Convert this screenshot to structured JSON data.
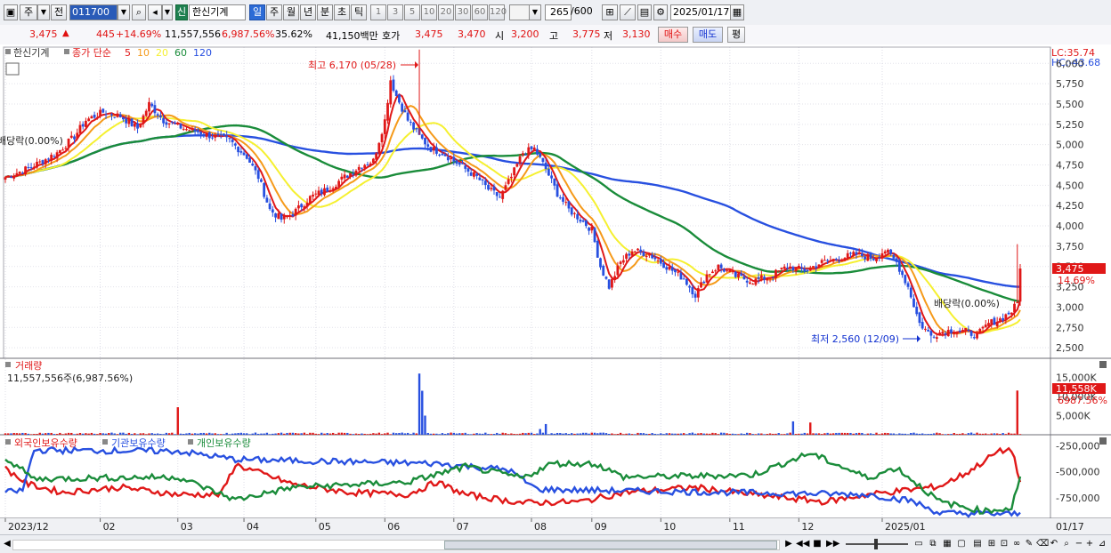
{
  "toolbar": {
    "market_label": "주",
    "prev_label": "전",
    "code": "011700",
    "stock_name_badge": "신",
    "stock_name": "한신기계",
    "periods": [
      "일",
      "주",
      "월",
      "년",
      "분",
      "초",
      "틱"
    ],
    "selected_period": "일",
    "minute_intervals": [
      "1",
      "3",
      "5",
      "10",
      "20",
      "30",
      "60",
      "120"
    ],
    "count": "265",
    "count_total": "/600",
    "date": "2025/01/17"
  },
  "info": {
    "price": "3,475",
    "change_arrow": "▲",
    "change": "445",
    "change_pct": "+14.69%",
    "volume": "11,557,556",
    "volume_pct": "6,987.56%",
    "turnover_pct": "35.62%",
    "amount": "41,150백만",
    "quote_label": "호가",
    "ask": "3,475",
    "bid": "3,470",
    "open_label": "시",
    "open": "3,200",
    "high_label": "고",
    "high": "3,775",
    "low_label": "저",
    "low": "3,130",
    "buy_button": "매수",
    "sell_button": "매도",
    "eval_button": "평"
  },
  "price_panel": {
    "stock_label": "한신기계",
    "legend_prefix": "종가 단순",
    "ma_periods": [
      "5",
      "10",
      "20",
      "60",
      "120"
    ],
    "ma_colors": [
      "#e01818",
      "#f59a1a",
      "#f5f030",
      "#1a8c3a",
      "#2850e0"
    ],
    "lc_label": "LC:35.74",
    "hc_label": "HC:-43.68",
    "high_annotation": "최고 6,170 (05/28)",
    "low_annotation": "최저 2,560 (12/09)",
    "dividend_left": "배당락(0.00%)",
    "dividend_right": "배당락(0.00%)",
    "current_price_tag": "3,475",
    "current_pct_tag": "14.69%"
  },
  "volume_panel": {
    "title": "거래량",
    "value": "11,557,556주(6,987.56%)",
    "tag": "11,558K",
    "tag_pct": "6987.56%"
  },
  "holding_panel": {
    "legend": [
      "외국인보유수량",
      "기관보유수량",
      "개인보유수량"
    ],
    "colors": [
      "#e01818",
      "#2850e0",
      "#1a8c3a"
    ]
  },
  "x_axis_labels": [
    "2023/12",
    "02",
    "03",
    "04",
    "05",
    "06",
    "07",
    "08",
    "09",
    "10",
    "11",
    "12",
    "2025/01"
  ],
  "x_axis_right_label": "01/17",
  "chart_data": [
    {
      "type": "candlestick",
      "title": "한신기계",
      "y_ticks": [
        6000,
        5750,
        5500,
        5250,
        5000,
        4750,
        4500,
        4250,
        4000,
        3750,
        3500,
        3250,
        3000,
        2750,
        2500
      ],
      "ylim": [
        2370,
        6200
      ],
      "anchors": [
        [
          0,
          4600
        ],
        [
          6,
          4680
        ],
        [
          12,
          4780
        ],
        [
          18,
          4900
        ],
        [
          24,
          5100
        ],
        [
          28,
          5300
        ],
        [
          34,
          5400
        ],
        [
          40,
          5350
        ],
        [
          46,
          5200
        ],
        [
          50,
          5500
        ],
        [
          55,
          5300
        ],
        [
          62,
          5200
        ],
        [
          68,
          5150
        ],
        [
          72,
          5100
        ],
        [
          78,
          5050
        ],
        [
          84,
          4850
        ],
        [
          88,
          4600
        ],
        [
          92,
          4200
        ],
        [
          96,
          4080
        ],
        [
          100,
          4150
        ],
        [
          106,
          4350
        ],
        [
          112,
          4450
        ],
        [
          118,
          4600
        ],
        [
          124,
          4750
        ],
        [
          128,
          4800
        ],
        [
          132,
          5300
        ],
        [
          134,
          5800
        ],
        [
          136,
          5600
        ],
        [
          140,
          5300
        ],
        [
          144,
          5100
        ],
        [
          148,
          4950
        ],
        [
          152,
          4900
        ],
        [
          156,
          4800
        ],
        [
          160,
          4700
        ],
        [
          164,
          4600
        ],
        [
          168,
          4450
        ],
        [
          172,
          4350
        ],
        [
          176,
          4600
        ],
        [
          180,
          4900
        ],
        [
          184,
          4950
        ],
        [
          188,
          4700
        ],
        [
          192,
          4400
        ],
        [
          196,
          4200
        ],
        [
          200,
          4080
        ],
        [
          204,
          3950
        ],
        [
          207,
          3500
        ],
        [
          210,
          3250
        ],
        [
          214,
          3550
        ],
        [
          218,
          3700
        ],
        [
          224,
          3650
        ],
        [
          230,
          3500
        ],
        [
          236,
          3350
        ],
        [
          240,
          3150
        ],
        [
          244,
          3400
        ],
        [
          248,
          3500
        ],
        [
          254,
          3380
        ],
        [
          260,
          3320
        ],
        [
          266,
          3380
        ],
        [
          272,
          3500
        ],
        [
          278,
          3450
        ],
        [
          284,
          3550
        ],
        [
          290,
          3600
        ],
        [
          296,
          3650
        ],
        [
          302,
          3600
        ],
        [
          306,
          3700
        ],
        [
          310,
          3550
        ],
        [
          314,
          3250
        ],
        [
          318,
          2800
        ],
        [
          322,
          2650
        ],
        [
          326,
          2700
        ],
        [
          330,
          2720
        ],
        [
          334,
          2700
        ],
        [
          338,
          2650
        ],
        [
          342,
          2800
        ],
        [
          346,
          2850
        ],
        [
          350,
          2950
        ],
        [
          352,
          3050
        ],
        [
          353,
          3475
        ]
      ],
      "volume_ticks": [
        15000,
        10000,
        5000
      ],
      "volume_tick_labels": [
        "15,000K",
        "10,000K",
        "5,000K"
      ],
      "volume_spikes": [
        [
          60,
          7200
        ],
        [
          144,
          16000
        ],
        [
          145,
          11500
        ],
        [
          146,
          5000
        ],
        [
          186,
          1500
        ],
        [
          188,
          2800
        ],
        [
          274,
          3500
        ],
        [
          280,
          3200
        ],
        [
          352,
          11558
        ]
      ]
    },
    {
      "type": "line",
      "title": "보유수량",
      "y_ticks": [
        -250000,
        -500000,
        -750000
      ],
      "y_tick_labels": [
        "-250,000",
        "-500,000",
        "-750,000"
      ],
      "ylim": [
        -950000,
        -150000
      ],
      "series": [
        {
          "name": "외국인보유수량",
          "color": "#e01818",
          "anchors": [
            [
              0,
              -470000
            ],
            [
              8,
              -620000
            ],
            [
              20,
              -700000
            ],
            [
              40,
              -650000
            ],
            [
              60,
              -720000
            ],
            [
              75,
              -720000
            ],
            [
              80,
              -430000
            ],
            [
              100,
              -620000
            ],
            [
              120,
              -700000
            ],
            [
              140,
              -720000
            ],
            [
              150,
              -600000
            ],
            [
              160,
              -720000
            ],
            [
              180,
              -800000
            ],
            [
              200,
              -790000
            ],
            [
              215,
              -700000
            ],
            [
              240,
              -650000
            ],
            [
              260,
              -720000
            ],
            [
              285,
              -790000
            ],
            [
              300,
              -720000
            ],
            [
              325,
              -640000
            ],
            [
              335,
              -500000
            ],
            [
              345,
              -310000
            ],
            [
              350,
              -280000
            ],
            [
              353,
              -600000
            ]
          ]
        },
        {
          "name": "기관보유수량",
          "color": "#2850e0",
          "anchors": [
            [
              0,
              -700000
            ],
            [
              6,
              -680000
            ],
            [
              10,
              -290000
            ],
            [
              60,
              -300000
            ],
            [
              80,
              -380000
            ],
            [
              150,
              -420000
            ],
            [
              175,
              -480000
            ],
            [
              185,
              -670000
            ],
            [
              230,
              -690000
            ],
            [
              300,
              -720000
            ],
            [
              315,
              -780000
            ],
            [
              325,
              -900000
            ],
            [
              353,
              -910000
            ]
          ]
        },
        {
          "name": "개인보유수량",
          "color": "#1a8c3a",
          "anchors": [
            [
              0,
              -360000
            ],
            [
              10,
              -570000
            ],
            [
              30,
              -560000
            ],
            [
              60,
              -550000
            ],
            [
              80,
              -770000
            ],
            [
              100,
              -650000
            ],
            [
              140,
              -600000
            ],
            [
              160,
              -450000
            ],
            [
              180,
              -560000
            ],
            [
              190,
              -420000
            ],
            [
              205,
              -420000
            ],
            [
              215,
              -550000
            ],
            [
              240,
              -540000
            ],
            [
              260,
              -530000
            ],
            [
              280,
              -320000
            ],
            [
              300,
              -560000
            ],
            [
              310,
              -460000
            ],
            [
              325,
              -790000
            ],
            [
              340,
              -880000
            ],
            [
              350,
              -850000
            ],
            [
              353,
              -540000
            ]
          ]
        }
      ]
    }
  ]
}
